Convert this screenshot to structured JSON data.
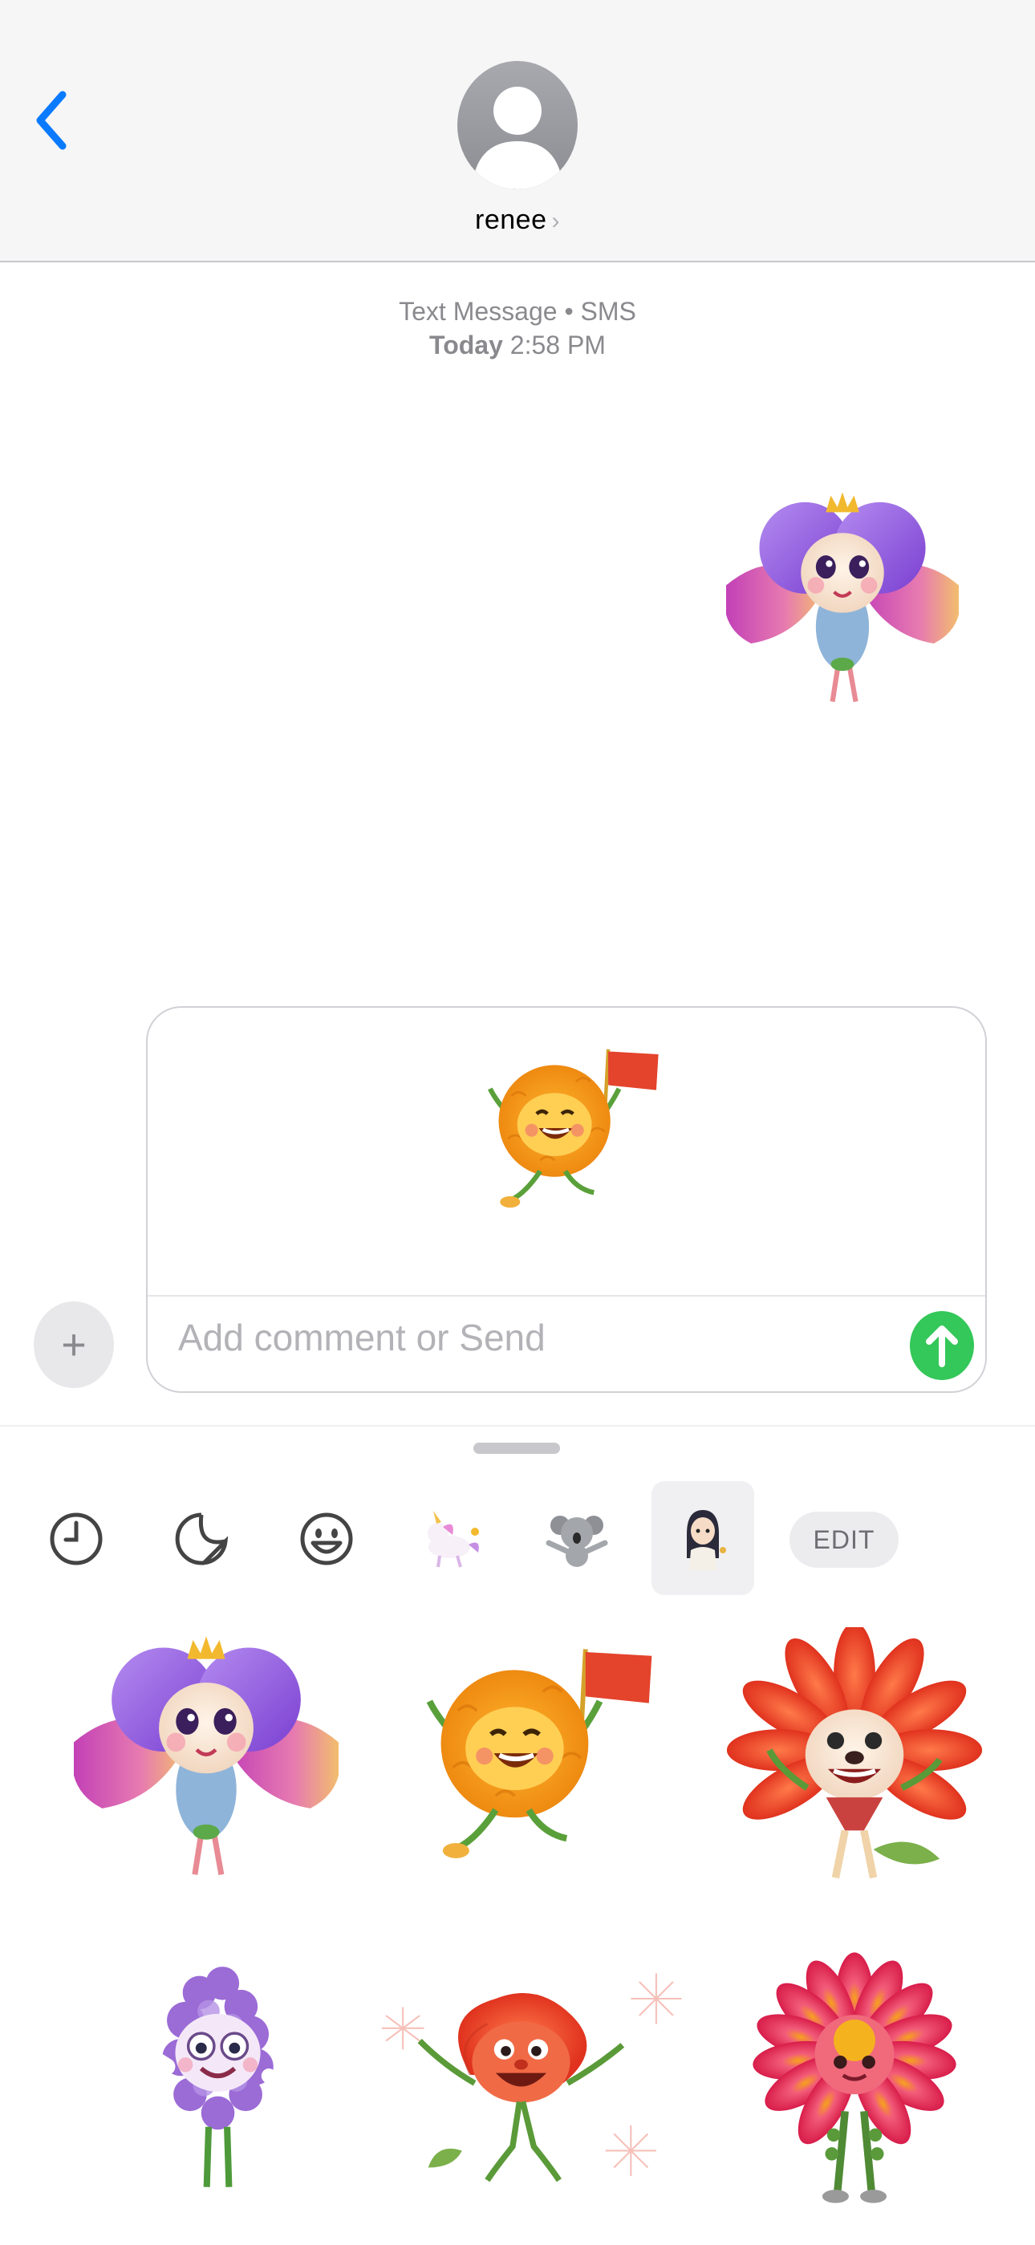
{
  "header": {
    "contact_name": "renee",
    "chevron": "›",
    "back_icon": "chevron-left-icon",
    "avatar_icon": "person-silhouette-icon"
  },
  "thread": {
    "service_label": "Text Message • SMS",
    "day_label": "Today",
    "time_label": "2:58 PM"
  },
  "compose": {
    "placeholder": "Add comment or Send",
    "plus_label": "+",
    "send_icon": "arrow-up-icon",
    "accent_color": "#34c759"
  },
  "drawer": {
    "tabs": [
      {
        "icon": "clock-icon"
      },
      {
        "icon": "sticker-peel-icon"
      },
      {
        "icon": "smiley-icon"
      },
      {
        "icon": "unicorn-sticker-pack-icon"
      },
      {
        "icon": "koala-sticker-pack-icon"
      },
      {
        "icon": "girl-sticker-pack-icon",
        "selected": true
      }
    ],
    "edit_label": "EDIT"
  },
  "stickers": [
    {
      "name": "iris-princess-sticker"
    },
    {
      "name": "marigold-flag-sticker"
    },
    {
      "name": "red-gerbera-sticker"
    },
    {
      "name": "lavender-peace-sticker"
    },
    {
      "name": "poppy-sparkler-sticker"
    },
    {
      "name": "dahlia-sticker"
    }
  ],
  "colors": {
    "ios_blue": "#0a7aff",
    "header_bg": "#f6f6f6",
    "timestamp_gray": "#8a8a8e"
  }
}
